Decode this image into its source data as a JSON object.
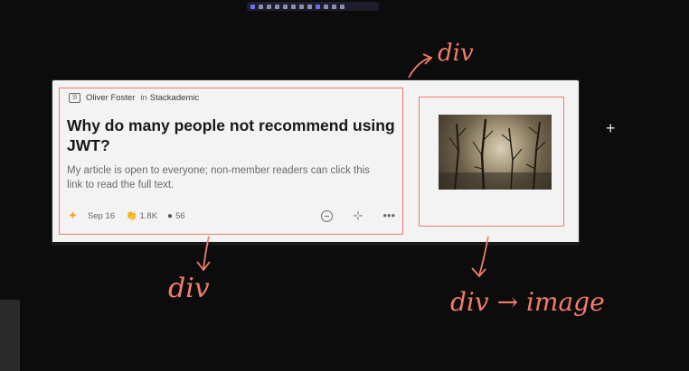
{
  "toolbar": {
    "tools": 12,
    "caption": ""
  },
  "card": {
    "author": {
      "avatar_text": "ℬ",
      "name": "Oliver Foster",
      "in_word": "in",
      "publication": "Stackademic"
    },
    "title": "Why do many people not recommend using JWT?",
    "subtitle": "My article is open to everyone; non-member readers can click this link to read the full text.",
    "meta": {
      "date": "Sep 16",
      "claps": "1.8K",
      "comments": "56"
    }
  },
  "annotations": {
    "top": "div",
    "left": "div",
    "right": "div → image"
  },
  "colors": {
    "annotation": "#f07c6c",
    "star": "#f5a623"
  }
}
